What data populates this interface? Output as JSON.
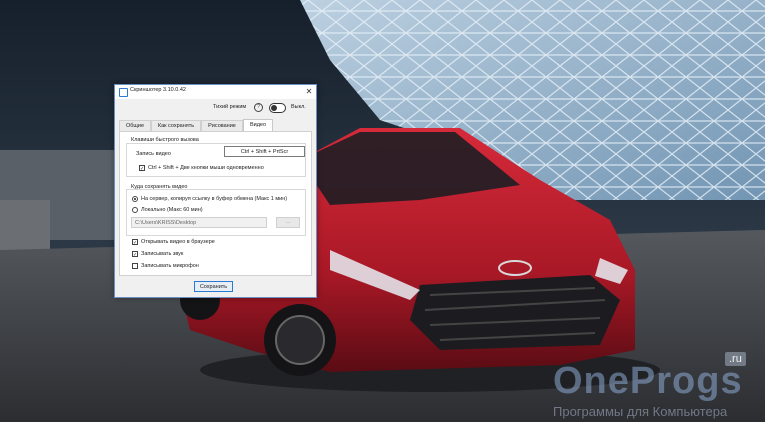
{
  "window": {
    "title": "Скриншотер 3.10.0.42",
    "close_glyph": "✕",
    "app_icon": "square-app-icon"
  },
  "quiet_mode": {
    "label": "Тихий режим",
    "help_glyph": "?",
    "state": "Выкл."
  },
  "tabs": [
    {
      "label": "Общие"
    },
    {
      "label": "Как сохранять"
    },
    {
      "label": "Рисование"
    },
    {
      "label": "Видео",
      "active": true
    }
  ],
  "hotkeys": {
    "title": "Клавиши быстрого вызова",
    "record_label": "Запись видео",
    "record_value": "Ctrl + Shift + PrtScr",
    "mouse_option": "Ctrl + Shift + Две кнопки мыши одновременно",
    "mouse_checked": true
  },
  "save_location": {
    "title": "Куда сохранять видео",
    "option_server": "На сервер, копируя ссылку в буфер обмена (Макс 1 мин)",
    "option_local": "Локально (Макс 60 мин)",
    "selected": "server",
    "path_value": "C:\\Users\\KRISS\\Desktop",
    "browse_label": "..."
  },
  "options": [
    {
      "label": "Открывать видео в браузере",
      "checked": true
    },
    {
      "label": "Записывать звук",
      "checked": true
    },
    {
      "label": "Записывать микрофон",
      "checked": false
    }
  ],
  "save_button": "Сохранить",
  "watermark": {
    "brand": "OneProgs",
    "tld": ".ru",
    "tagline": "Программы для Компьютера"
  },
  "colors": {
    "accent": "#2a7ad4",
    "car": "#b01c2a"
  }
}
